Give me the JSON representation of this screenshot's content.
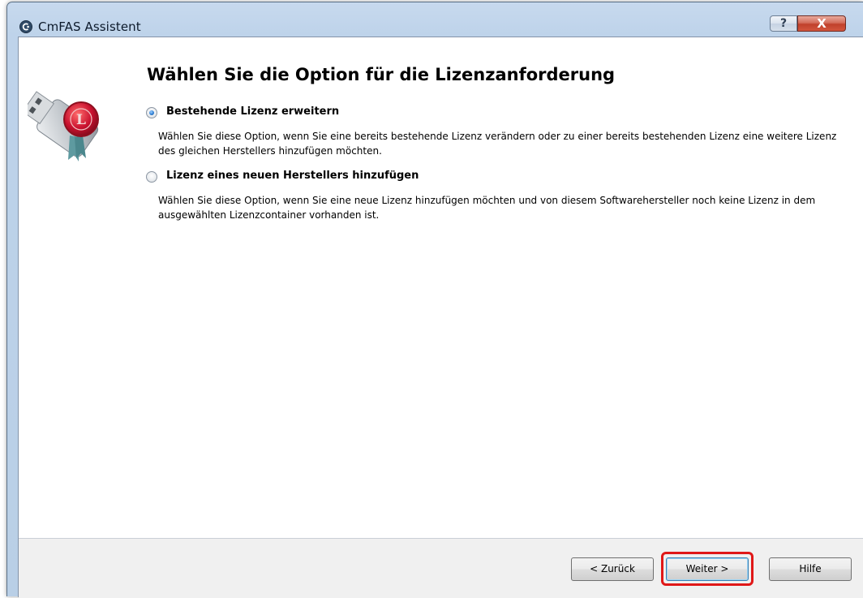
{
  "window": {
    "title": "CmFAS Assistent",
    "help_glyph": "?",
    "close_glyph": "X"
  },
  "page": {
    "heading": "Wählen Sie die Option für die Lizenzanforderung",
    "options": [
      {
        "label": "Bestehende Lizenz erweitern",
        "selected": true,
        "description": "Wählen Sie diese Option, wenn Sie eine bereits bestehende Lizenz verändern oder zu einer bereits bestehenden Lizenz eine weitere Lizenz des gleichen Herstellers hinzufügen möchten."
      },
      {
        "label": "Lizenz eines neuen Herstellers hinzufügen",
        "selected": false,
        "description": "Wählen Sie diese Option, wenn Sie eine neue Lizenz hinzufügen möchten und von diesem Softwarehersteller noch keine Lizenz in dem ausgewählten Lizenzcontainer vorhanden ist."
      }
    ]
  },
  "footer": {
    "back_label": "< Zurück",
    "next_label": "Weiter >",
    "help_label": "Hilfe"
  },
  "icons": {
    "app": "cmfas-app-icon",
    "logo": "usb-dongle-license-seal-icon",
    "help": "help-icon",
    "close": "close-icon"
  },
  "colors": {
    "highlight": "#e01818",
    "title_bar": "#bed3ea",
    "seal": "#c8102e"
  }
}
